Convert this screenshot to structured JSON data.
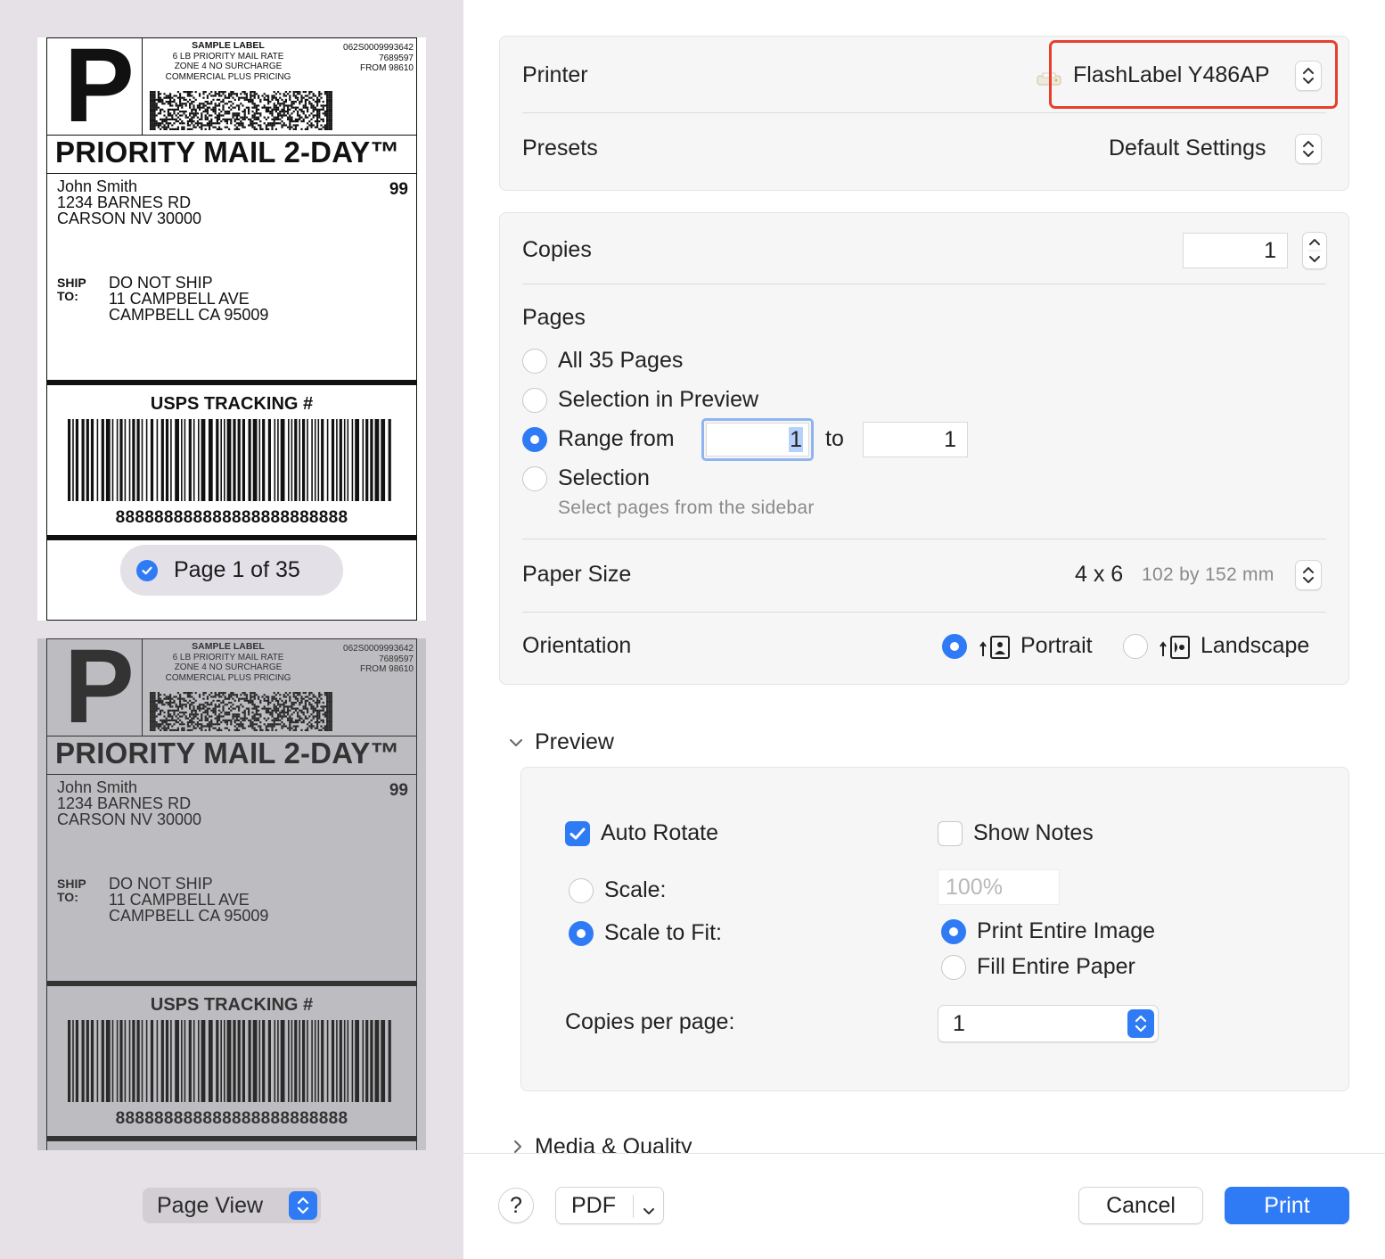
{
  "sidebar": {
    "label": {
      "p_letter": "P",
      "sample_lines": [
        "SAMPLE LABEL",
        "6 LB PRIORITY MAIL RATE",
        "ZONE 4 NO SURCHARGE",
        "COMMERCIAL PLUS PRICING"
      ],
      "tracking_lines": [
        "062S0009993642",
        "7689597",
        "FROM 98610"
      ],
      "service_title": "PRIORITY MAIL 2-DAY™",
      "from_lines": [
        "John Smith",
        "1234 BARNES RD",
        "CARSON NV 30000"
      ],
      "code": "99",
      "ship_to_label_lines": [
        "SHIP",
        "TO:"
      ],
      "ship_to_lines": [
        "DO NOT SHIP",
        "11 CAMPBELL AVE",
        "CAMPBELL CA 95009"
      ],
      "usps_tracking": "USPS TRACKING #",
      "tracking_number": "888888888888888888888888"
    },
    "page_badge": "Page 1 of 35",
    "page_view": "Page View"
  },
  "printer": {
    "label": "Printer",
    "value": "FlashLabel Y486AP"
  },
  "presets": {
    "label": "Presets",
    "value": "Default Settings"
  },
  "copies": {
    "label": "Copies",
    "value": "1"
  },
  "pages": {
    "label": "Pages",
    "options": {
      "all": "All 35 Pages",
      "selection_preview": "Selection in Preview",
      "range": "Range from",
      "selection": "Selection"
    },
    "selected": "range",
    "range_from": "1",
    "range_to_label": "to",
    "range_to": "1",
    "selection_hint": "Select pages from the sidebar"
  },
  "paper_size": {
    "label": "Paper Size",
    "value": "4 x 6",
    "detail": "102 by 152 mm"
  },
  "orientation": {
    "label": "Orientation",
    "portrait": "Portrait",
    "landscape": "Landscape",
    "selected": "portrait"
  },
  "preview_section": {
    "title": "Preview",
    "auto_rotate": "Auto Rotate",
    "auto_rotate_checked": true,
    "show_notes": "Show Notes",
    "show_notes_checked": false,
    "scale_label": "Scale:",
    "scale_value": "100%",
    "scale_to_fit_label": "Scale to Fit:",
    "print_entire_image": "Print Entire Image",
    "fill_entire_paper": "Fill Entire Paper",
    "copies_per_page_label": "Copies per page:",
    "copies_per_page_value": "1"
  },
  "media_quality": {
    "title": "Media & Quality"
  },
  "footer": {
    "help": "?",
    "pdf": "PDF",
    "cancel": "Cancel",
    "print": "Print"
  },
  "colors": {
    "accent": "#2f7bf5",
    "highlight_box": "#e5402e"
  }
}
